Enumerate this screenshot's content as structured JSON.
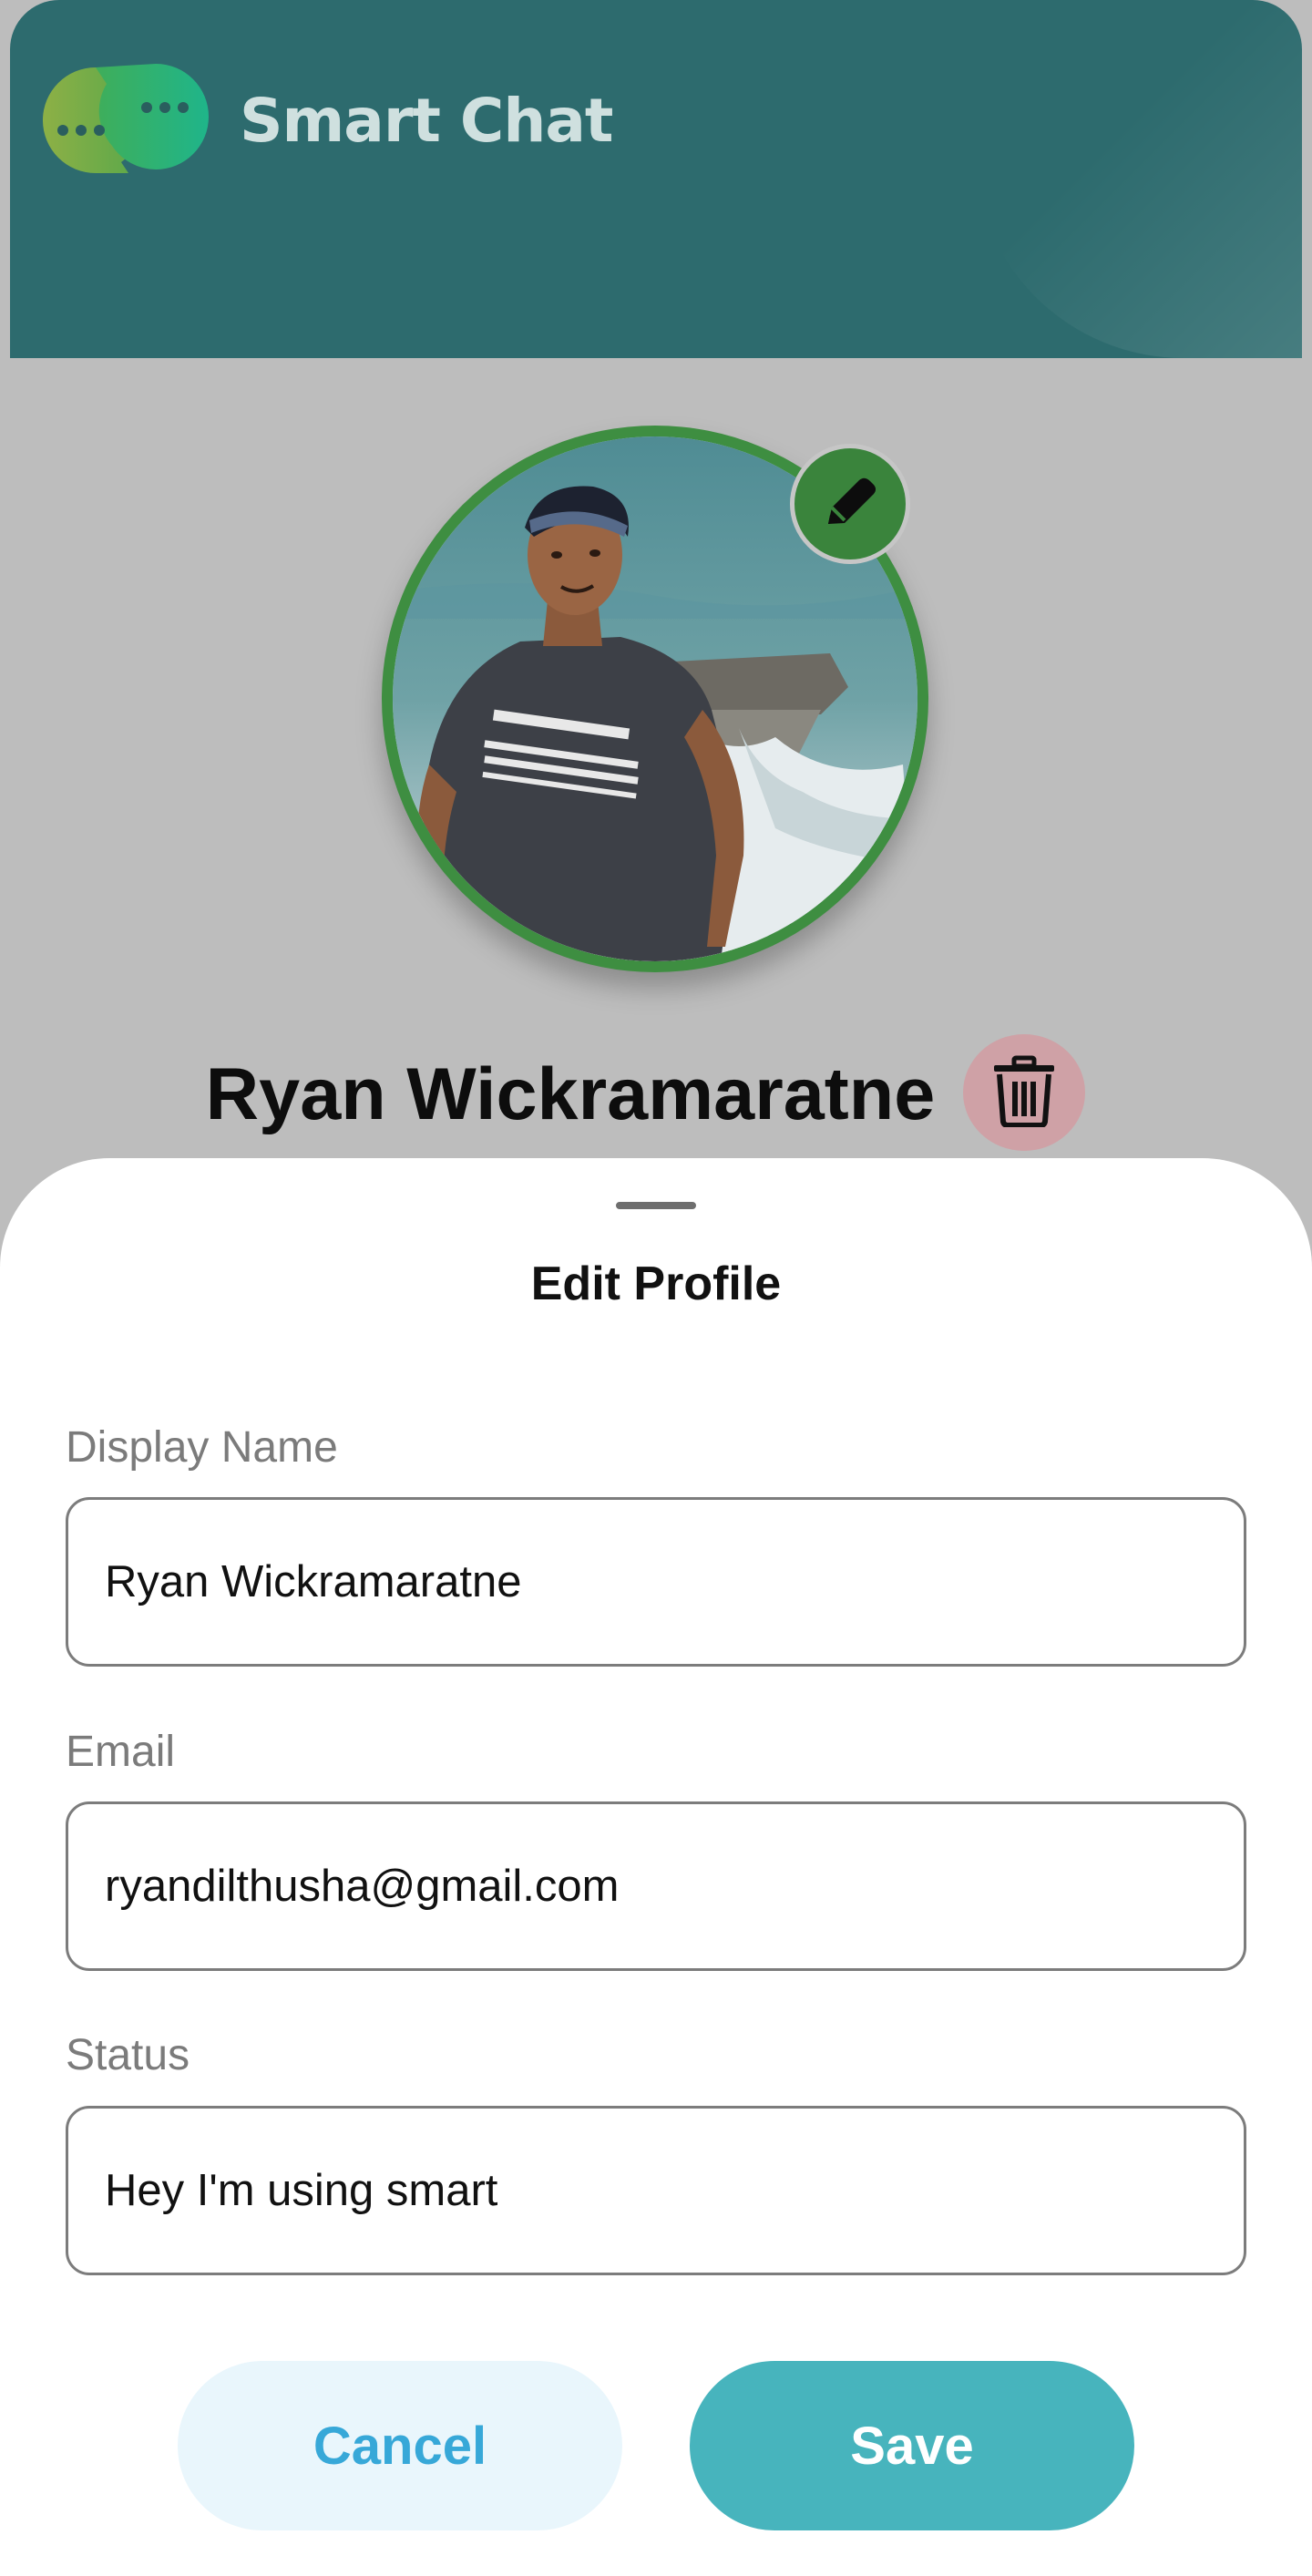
{
  "app": {
    "title": "Smart Chat",
    "logo_icon": "chat-bubbles-icon"
  },
  "profile": {
    "name": "Ryan Wickramaratne",
    "edit_photo_icon": "pencil-icon",
    "delete_icon": "trash-icon"
  },
  "sheet": {
    "title": "Edit Profile",
    "fields": [
      {
        "label": "Display Name",
        "value": "Ryan Wickramaratne"
      },
      {
        "label": "Email",
        "value": "ryandilthusha@gmail.com"
      },
      {
        "label": "Status",
        "value": "Hey I'm using smart"
      }
    ],
    "cancel_label": "Cancel",
    "save_label": "Save"
  },
  "colors": {
    "header": "#2d6b6e",
    "ring": "#3e8e41",
    "save": "#47b4bd",
    "cancel_bg": "#e9f6fc",
    "cancel_text": "#37a8d8",
    "delete_bg": "#cfa1a6"
  }
}
